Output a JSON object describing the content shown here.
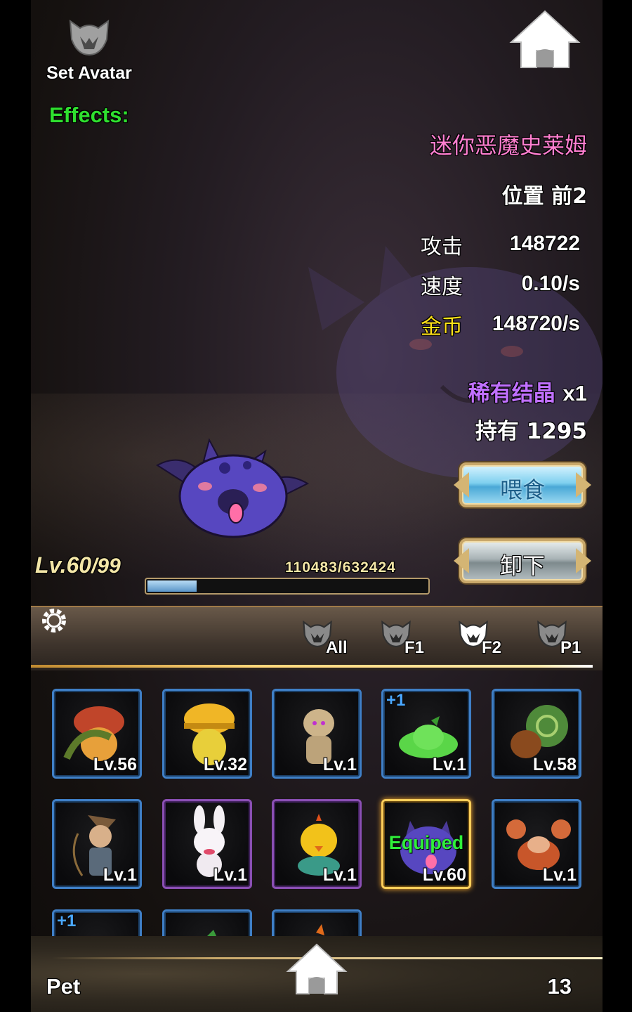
{
  "header": {
    "set_avatar_label": "Set Avatar",
    "effects_label": "Effects:"
  },
  "pet": {
    "name": "迷你恶魔史莱姆",
    "position": "位置 前2",
    "stats": [
      {
        "label": "攻击",
        "value": "148722",
        "color": "#ffffff"
      },
      {
        "label": "速度",
        "value": "0.10/s",
        "color": "#ffffff"
      },
      {
        "label": "金币",
        "value": "148720/s",
        "color": "#ffe21a"
      }
    ],
    "rare_item": "稀有结晶",
    "rare_qty": "x1",
    "hold": "持有 1295",
    "level": "Lv.60",
    "max_level": "/99",
    "exp": "110483/632424",
    "exp_fraction": 0.1747
  },
  "buttons": {
    "feed": "喂食",
    "unequip": "卸下"
  },
  "tabs": [
    {
      "label": "All",
      "active": false
    },
    {
      "label": "F1",
      "active": false
    },
    {
      "label": "F2",
      "active": true
    },
    {
      "label": "P1",
      "active": false
    }
  ],
  "pets": [
    {
      "lv": "Lv.56",
      "frame": "blue",
      "plus": "",
      "equipped": "",
      "icon": "mushroom-pet-icon"
    },
    {
      "lv": "Lv.32",
      "frame": "blue",
      "plus": "",
      "equipped": "",
      "icon": "hardhat-pet-icon"
    },
    {
      "lv": "Lv.1",
      "frame": "blue",
      "plus": "",
      "equipped": "",
      "icon": "mummy-pet-icon"
    },
    {
      "lv": "Lv.1",
      "frame": "blue",
      "plus": "+1",
      "equipped": "",
      "icon": "green-slime-pet-icon"
    },
    {
      "lv": "Lv.58",
      "frame": "blue",
      "plus": "",
      "equipped": "",
      "icon": "snail-pet-icon"
    },
    {
      "lv": "Lv.1",
      "frame": "blue",
      "plus": "",
      "equipped": "",
      "icon": "archer-pet-icon"
    },
    {
      "lv": "Lv.1",
      "frame": "purple",
      "plus": "",
      "equipped": "",
      "icon": "bunny-pet-icon"
    },
    {
      "lv": "Lv.1",
      "frame": "purple",
      "plus": "",
      "equipped": "",
      "icon": "chick-pet-icon"
    },
    {
      "lv": "Lv.60",
      "frame": "gold",
      "plus": "",
      "equipped": "Equiped",
      "icon": "demon-slime-pet-icon"
    },
    {
      "lv": "Lv.1",
      "frame": "blue",
      "plus": "",
      "equipped": "",
      "icon": "crab-pet-icon"
    },
    {
      "lv": "",
      "frame": "blue",
      "plus": "+1",
      "equipped": "",
      "icon": "ghost-pet-icon"
    },
    {
      "lv": "",
      "frame": "blue",
      "plus": "",
      "equipped": "",
      "icon": "bird-pet-icon"
    },
    {
      "lv": "",
      "frame": "blue",
      "plus": "",
      "equipped": "",
      "icon": "egg-pet-icon"
    }
  ],
  "footer": {
    "label": "Pet",
    "count": "13"
  }
}
